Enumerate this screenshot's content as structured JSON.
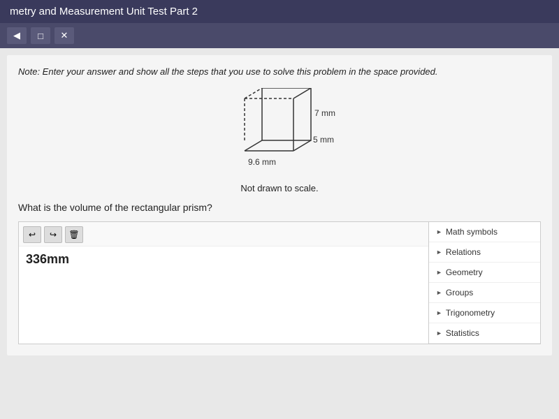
{
  "title": {
    "text": "metry and Measurement Unit Test Part 2"
  },
  "toolbar": {
    "buttons": [
      "arrow",
      "copy",
      "close"
    ]
  },
  "note": {
    "text": "Note: Enter your answer and show all the steps that you use to solve this problem in the space provided."
  },
  "diagram": {
    "dimension_top": "7 mm",
    "dimension_right": "5 mm",
    "dimension_bottom": "9.6 mm",
    "caption": "Not drawn to scale."
  },
  "question": {
    "text": "What is the volume of the rectangular prism?"
  },
  "answer": {
    "value": "336mm"
  },
  "sidebar": {
    "items": [
      {
        "label": "Math symbols"
      },
      {
        "label": "Relations"
      },
      {
        "label": "Geometry"
      },
      {
        "label": "Groups"
      },
      {
        "label": "Trigonometry"
      },
      {
        "label": "Statistics"
      }
    ]
  }
}
